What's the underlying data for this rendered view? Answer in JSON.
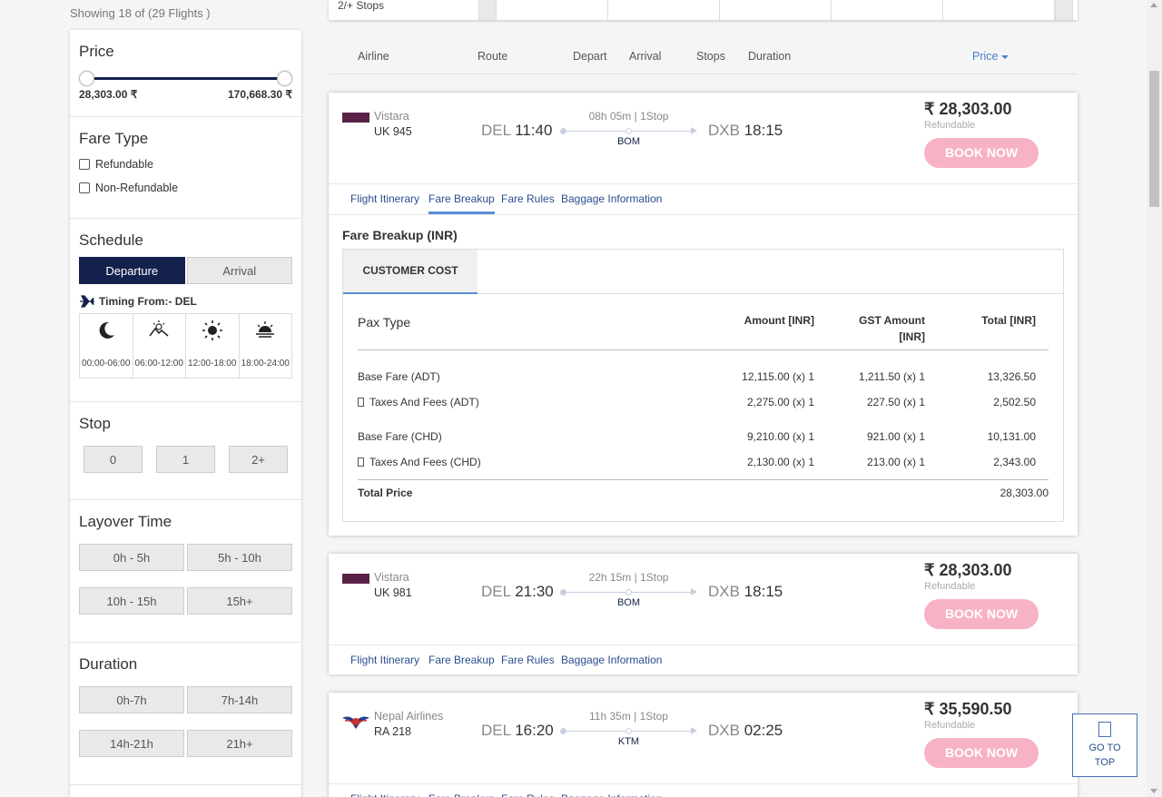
{
  "results": {
    "showing": "Showing 18 of (29 Flights )"
  },
  "filters": {
    "price": {
      "title": "Price",
      "min": "28,303.00 ₹",
      "max": "170,668.30 ₹",
      "range_low_fraction": 0.0,
      "range_high_fraction": 1.0
    },
    "fare_type": {
      "title": "Fare Type",
      "options": [
        "Refundable",
        "Non-Refundable"
      ]
    },
    "schedule": {
      "title": "Schedule",
      "tabs": [
        "Departure",
        "Arrival"
      ],
      "timing_label": "Timing From:- DEL",
      "slots": [
        "00:00-06:00",
        "06:00-12:00",
        "12:00-18:00",
        "18:00-24:00"
      ]
    },
    "stop": {
      "title": "Stop",
      "options": [
        "0",
        "1",
        "2+"
      ]
    },
    "layover": {
      "title": "Layover Time",
      "options": [
        "0h - 5h",
        "5h - 10h",
        "10h - 15h",
        "15h+"
      ]
    },
    "duration": {
      "title": "Duration",
      "options": [
        "0h-7h",
        "7h-14h",
        "14h-21h",
        "21h+"
      ]
    }
  },
  "strip": {
    "label": "2/+ Stops"
  },
  "columns": {
    "airline": "Airline",
    "route": "Route",
    "depart": "Depart",
    "arrival": "Arrival",
    "stops": "Stops",
    "duration": "Duration",
    "price": "Price"
  },
  "tabs": {
    "itinerary": "Flight Itinerary",
    "fare_breakup": "Fare Breakup",
    "fare_rules": "Fare Rules",
    "baggage": "Baggage Information"
  },
  "book_label": "BOOK NOW",
  "flights": [
    {
      "airline": "Vistara",
      "code": "UK  945",
      "dep_code": "DEL",
      "dep_time": "11:40",
      "arr_code": "DXB",
      "arr_time": "18:15",
      "duration": "08h 05m | 1Stop",
      "via": "BOM",
      "price": "₹ 28,303.00",
      "refund": "Refundable"
    },
    {
      "airline": "Vistara",
      "code": "UK  981",
      "dep_code": "DEL",
      "dep_time": "21:30",
      "arr_code": "DXB",
      "arr_time": "18:15",
      "duration": "22h 15m | 1Stop",
      "via": "BOM",
      "price": "₹ 28,303.00",
      "refund": "Refundable"
    },
    {
      "airline": "Nepal Airlines",
      "code": "RA  218",
      "dep_code": "DEL",
      "dep_time": "16:20",
      "arr_code": "DXB",
      "arr_time": "02:25",
      "duration": "11h 35m | 1Stop",
      "via": "KTM",
      "price": "₹ 35,590.50",
      "refund": "Refundable"
    }
  ],
  "fare": {
    "title": "Fare Breakup (INR)",
    "tab": "CUSTOMER COST",
    "headers": {
      "pax": "Pax Type",
      "amount": "Amount [INR]",
      "gst_1": "GST Amount",
      "gst_2": "[INR]",
      "total": "Total [INR]"
    },
    "rows": [
      {
        "label": "Base Fare (ADT)",
        "amount": "12,115.00 (x) 1",
        "gst": "1,211.50 (x) 1",
        "total": "13,326.50"
      },
      {
        "label": "Taxes And Fees (ADT)",
        "amount": "2,275.00 (x) 1",
        "gst": "227.50 (x) 1",
        "total": "2,502.50"
      },
      {
        "label": "Base Fare (CHD)",
        "amount": "9,210.00 (x) 1",
        "gst": "921.00 (x) 1",
        "total": "10,131.00"
      },
      {
        "label": "Taxes And Fees (CHD)",
        "amount": "2,130.00 (x) 1",
        "gst": "213.00 (x) 1",
        "total": "2,343.00"
      }
    ],
    "total_label": "Total Price",
    "total_value": "28,303.00"
  },
  "go_top": {
    "line1": "GO TO",
    "line2": "TOP"
  }
}
